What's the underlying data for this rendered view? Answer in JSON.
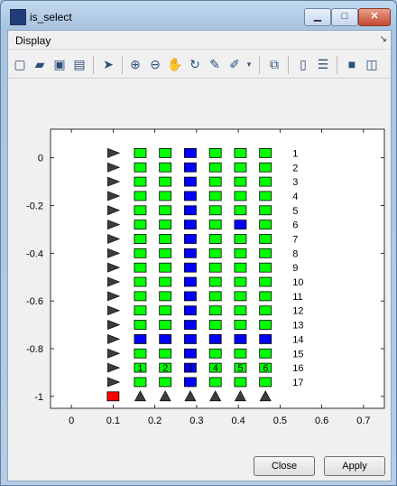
{
  "window": {
    "title": "is_select"
  },
  "menu": {
    "display_label": "Display",
    "dock_glyph": "↘"
  },
  "toolbar_icons": [
    "new-figure-icon",
    "open-file-icon",
    "save-icon",
    "print-icon",
    "pointer-icon",
    "zoom-in-icon",
    "zoom-out-icon",
    "pan-icon",
    "rotate-3d-icon",
    "data-cursor-icon",
    "brush-icon",
    "brush-dropdown-icon",
    "link-plot-icon",
    "colorbar-icon",
    "legend-icon",
    "hide-plot-tools-icon",
    "show-plot-tools-icon"
  ],
  "buttons": {
    "close": "Close",
    "apply": "Apply"
  },
  "colors": {
    "selected": "#0000ff",
    "unselected": "#00ff00",
    "marker_edge": "#000000",
    "special": "#ff0000",
    "triangle": "#3c3c3c"
  },
  "chart_data": {
    "type": "scatter",
    "xlim": [
      -0.05,
      0.75
    ],
    "ylim": [
      -1.05,
      0.12
    ],
    "x_ticks": [
      0,
      0.1,
      0.2,
      0.3,
      0.4,
      0.5,
      0.6,
      0.7
    ],
    "x_tick_labels": [
      "0",
      "0.1",
      "0.2",
      "0.3",
      "0.4",
      "0.5",
      "0.6",
      "0.7"
    ],
    "y_ticks": [
      0,
      -0.2,
      -0.4,
      -0.6,
      -0.8,
      -1
    ],
    "y_tick_labels": [
      "0",
      "-0.2",
      "-0.4",
      "-0.6",
      "-0.8",
      "-1"
    ],
    "row_arrow_x": 0.1,
    "column_x": [
      0.165,
      0.225,
      0.285,
      0.345,
      0.405,
      0.465
    ],
    "row_label_x": 0.53,
    "rows": [
      {
        "label": "1",
        "y": 0.02,
        "selected": [
          false,
          false,
          true,
          false,
          false,
          false
        ]
      },
      {
        "label": "2",
        "y": -0.04,
        "selected": [
          false,
          false,
          true,
          false,
          false,
          false
        ]
      },
      {
        "label": "3",
        "y": -0.1,
        "selected": [
          false,
          false,
          true,
          false,
          false,
          false
        ]
      },
      {
        "label": "4",
        "y": -0.16,
        "selected": [
          false,
          false,
          true,
          false,
          false,
          false
        ]
      },
      {
        "label": "5",
        "y": -0.22,
        "selected": [
          false,
          false,
          true,
          false,
          false,
          false
        ]
      },
      {
        "label": "6",
        "y": -0.28,
        "selected": [
          false,
          false,
          true,
          false,
          true,
          false
        ]
      },
      {
        "label": "7",
        "y": -0.34,
        "selected": [
          false,
          false,
          true,
          false,
          false,
          false
        ]
      },
      {
        "label": "8",
        "y": -0.4,
        "selected": [
          false,
          false,
          true,
          false,
          false,
          false
        ]
      },
      {
        "label": "9",
        "y": -0.46,
        "selected": [
          false,
          false,
          true,
          false,
          false,
          false
        ]
      },
      {
        "label": "10",
        "y": -0.52,
        "selected": [
          false,
          false,
          true,
          false,
          false,
          false
        ]
      },
      {
        "label": "11",
        "y": -0.58,
        "selected": [
          false,
          false,
          true,
          false,
          false,
          false
        ]
      },
      {
        "label": "12",
        "y": -0.64,
        "selected": [
          false,
          false,
          true,
          false,
          false,
          false
        ]
      },
      {
        "label": "13",
        "y": -0.7,
        "selected": [
          false,
          false,
          true,
          false,
          false,
          false
        ]
      },
      {
        "label": "14",
        "y": -0.76,
        "selected": [
          true,
          true,
          true,
          true,
          true,
          true
        ]
      },
      {
        "label": "15",
        "y": -0.82,
        "selected": [
          false,
          false,
          true,
          false,
          false,
          false
        ]
      },
      {
        "label": "16",
        "y": -0.88,
        "selected": [
          false,
          false,
          true,
          false,
          false,
          false
        ],
        "marker_labels": [
          "1",
          "2",
          "3",
          "4",
          "5",
          "6"
        ]
      },
      {
        "label": "17",
        "y": -0.94,
        "selected": [
          false,
          false,
          true,
          false,
          false,
          false
        ]
      }
    ],
    "bottom_row": {
      "y": -1.0,
      "corner_x": 0.1,
      "triangle_x": [
        0.165,
        0.225,
        0.285,
        0.345,
        0.405,
        0.465
      ]
    }
  }
}
